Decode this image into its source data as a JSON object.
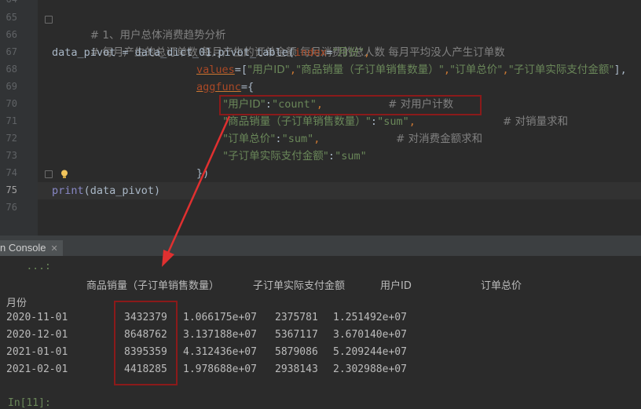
{
  "editor": {
    "line_numbers": [
      "64",
      "65",
      "66",
      "67",
      "68",
      "69",
      "70",
      "71",
      "72",
      "73",
      "74",
      "75",
      "76"
    ],
    "lines": {
      "l65": {
        "hash": "#",
        "text": " 1、用户总体消费趋势分析"
      },
      "l66": {
        "hash": "#",
        "text": " 每月产生的总订单数 每月产生的订单金额 每月消费的总人数 每月平均没人产生订单数"
      },
      "l67": {
        "var": "data_pivot",
        "eq": " = ",
        "obj": "data_dict_01.pivot_table(",
        "kw": "index",
        "assign": "=",
        "str": "\"月份\"",
        "comma": ","
      },
      "l68": {
        "kw": "values",
        "assign": "=[",
        "s1": "\"用户ID\"",
        "c1": ",",
        "s2": "\"商品销量（子订单销售数量）\"",
        "c2": ",",
        "s3": "\"订单总价\"",
        "c3": ",",
        "s4": "\"子订单实际支付金额\"",
        "end": "],"
      },
      "l69": {
        "kw": "aggfunc",
        "assign": "={"
      },
      "l70": {
        "s1": "\"用户ID\"",
        "colon": ":",
        "s2": "\"count\"",
        "comma": ",",
        "cmt": "# 对用户计数"
      },
      "l71": {
        "s1": "\"商品销量（子订单销售数量）\"",
        "colon": ":",
        "s2": "\"sum\"",
        "comma": ",",
        "cmt": "# 对销量求和"
      },
      "l72": {
        "s1": "\"订单总价\"",
        "colon": ":",
        "s2": "\"sum\"",
        "comma": ",",
        "cmt": "# 对消费金额求和"
      },
      "l73": {
        "s1": "\"子订单实际支付金额\"",
        "colon": ":",
        "s2": "\"sum\""
      },
      "l74": {
        "text": "})"
      },
      "l75": {
        "fn": "print",
        "args": "(data_pivot)"
      }
    }
  },
  "console": {
    "tab_label": "n Console",
    "tab_close": "✕",
    "continuation": "   ...:",
    "headers": [
      "商品销量（子订单销售数量）",
      "子订单实际支付金额",
      "用户ID",
      "订单总价"
    ],
    "index_name": "月份",
    "rows": [
      {
        "date": "2020-11-01",
        "v1": "3432379",
        "v2": "1.066175e+07",
        "v3": "2375781",
        "v4": "1.251492e+07"
      },
      {
        "date": "2020-12-01",
        "v1": "8648762",
        "v2": "3.137188e+07",
        "v3": "5367117",
        "v4": "3.670140e+07"
      },
      {
        "date": "2021-01-01",
        "v1": "8395359",
        "v2": "4.312436e+07",
        "v3": "5879086",
        "v4": "5.209244e+07"
      },
      {
        "date": "2021-02-01",
        "v1": "4418285",
        "v2": "1.978688e+07",
        "v3": "2938143",
        "v4": "2.302988e+07"
      }
    ],
    "next_prompt": "In[11]:"
  },
  "colors": {
    "annotation_red": "#8b1a1a",
    "arrow_red": "#e03030"
  }
}
